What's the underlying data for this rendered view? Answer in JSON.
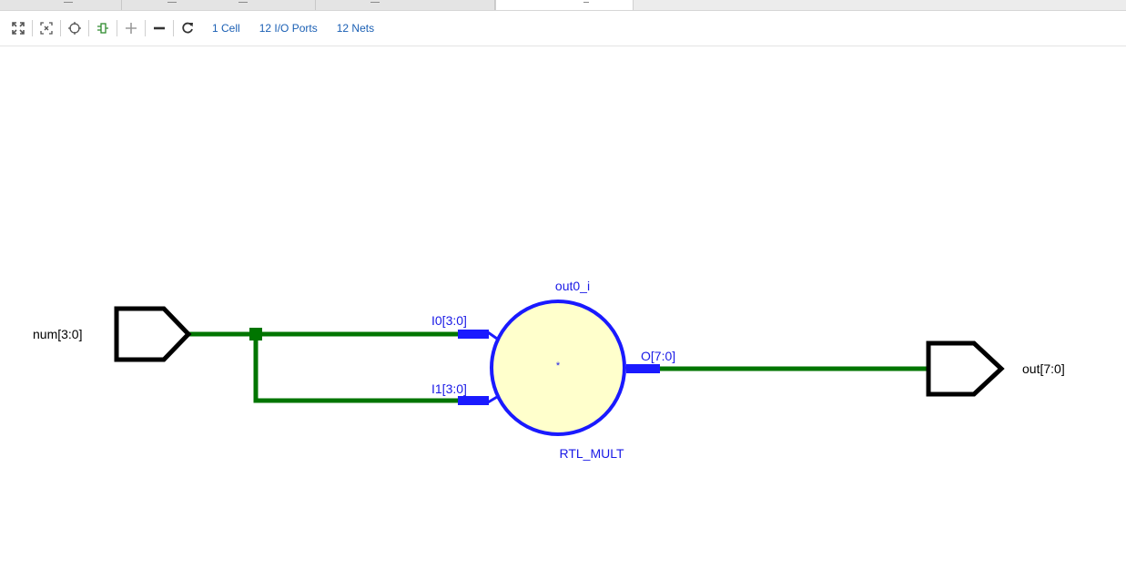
{
  "toolbar": {
    "buttons": [
      {
        "name": "fit-view-icon"
      },
      {
        "name": "zoom-selection-icon"
      },
      {
        "name": "crosshair-icon"
      },
      {
        "name": "cell-icon"
      },
      {
        "name": "zoom-in-icon"
      },
      {
        "name": "zoom-out-icon"
      },
      {
        "name": "refresh-icon"
      }
    ],
    "stats": {
      "cells": "1 Cell",
      "ports": "12 I/O Ports",
      "nets": "12 Nets"
    }
  },
  "schematic": {
    "input_port_label": "num[3:0]",
    "output_port_label": "out[7:0]",
    "cell_instance": "out0_i",
    "cell_type": "RTL_MULT",
    "cell_symbol": "*",
    "pin_i0": "I0[3:0]",
    "pin_i1": "I1[3:0]",
    "pin_o": "O[7:0]",
    "colors": {
      "net": "#007500",
      "cell_outline": "#1a1aff",
      "cell_fill": "#ffffcc",
      "port": "#000000",
      "cell_text": "#1a1ae6"
    }
  }
}
